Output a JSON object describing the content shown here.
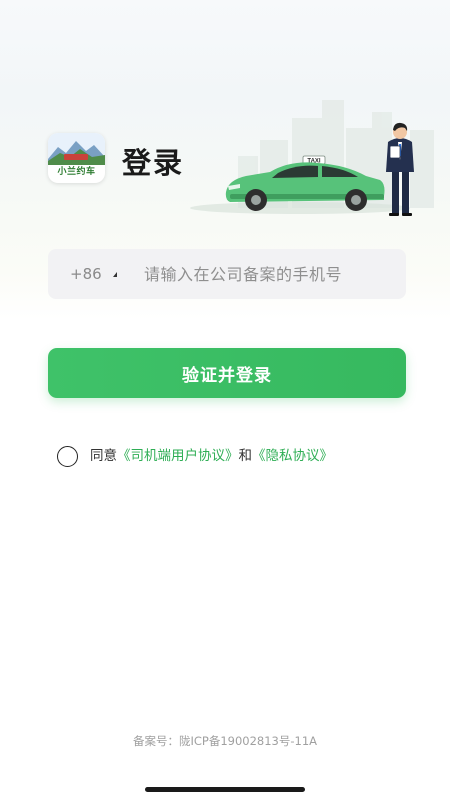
{
  "app": {
    "logo_text": "小兰约车",
    "page_title": "登录",
    "hero_taxi_sign": "TAXI"
  },
  "login_form": {
    "country_code": "+86",
    "phone_placeholder": "请输入在公司备案的手机号",
    "submit_label": "验证并登录"
  },
  "agreement": {
    "checked": false,
    "prefix": "同意",
    "driver_agreement_link": "《司机端用户协议》",
    "connector": "和",
    "privacy_link": "《隐私协议》"
  },
  "footer": {
    "icp_text": "备案号：陇ICP备19002813号-11A"
  },
  "colors": {
    "accent_green": "#3cbf66",
    "link_green": "#2fae55"
  }
}
